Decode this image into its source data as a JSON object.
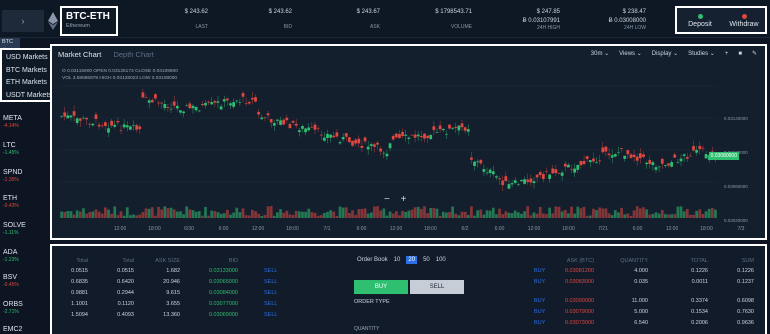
{
  "header": {
    "collapse_icon": "chevron-right-icon",
    "pair": "BTC-ETH",
    "pair_sub": "Ethereum",
    "stats": [
      {
        "value": "$ 243.62",
        "value2": "",
        "label": "LAST"
      },
      {
        "value": "$ 243.62",
        "value2": "",
        "label": "BID"
      },
      {
        "value": "$ 243.67",
        "value2": "",
        "label": "ASK"
      },
      {
        "value": "$ 1798543.71",
        "value2": "",
        "label": "VOLUME"
      },
      {
        "value": "$ 247.85",
        "value2": "Ƀ 0.03107991",
        "label": "24H HIGH"
      },
      {
        "value": "$ 238.47",
        "value2": "Ƀ 0.03008000",
        "label": "24H LOW"
      }
    ],
    "deposit_label": "Deposit",
    "withdraw_label": "Withdraw"
  },
  "market_select": "BTC",
  "markets_dropdown": [
    "USD Markets",
    "BTC Markets",
    "ETH Markets",
    "USDT Markets"
  ],
  "coins": [
    {
      "name": "META",
      "change": "-4.14%",
      "dir": "neg"
    },
    {
      "name": "LTC",
      "change": "-1.45%",
      "dir": "pos"
    },
    {
      "name": "SPND",
      "change": "-1.35%",
      "dir": "neg"
    },
    {
      "name": "ETH",
      "change": "-0.43%",
      "dir": "neg"
    },
    {
      "name": "SOLVE",
      "change": "-1.11%",
      "dir": "pos"
    },
    {
      "name": "ADA",
      "change": "-1.23%",
      "dir": "pos"
    },
    {
      "name": "BSV",
      "change": "-0.45%",
      "dir": "neg"
    },
    {
      "name": "ORBS",
      "change": "-2.71%",
      "dir": "pos"
    },
    {
      "name": "EMC2",
      "change": "",
      "dir": "neg"
    }
  ],
  "chart": {
    "tab_active": "Market Chart",
    "tab_inactive": "Depth Chart",
    "controls": [
      "30m ⌄",
      "Views ⌄",
      "Display ⌄",
      "Studies ⌄",
      "+",
      "■",
      "✎"
    ],
    "ohlc_line1": "O 0.03115900  OPEN  0.03125173  CLOSE  0.03109800",
    "ohlc_line2": "VOL  3.58686978  HIGH  0.03128023  LOW  0.03108000",
    "price_labels": [
      "0.03140000",
      "0.03100000",
      "0.03060000",
      "0.03020000"
    ],
    "current_price": "0.03080000",
    "x_labels": [
      "12:00",
      "18:00",
      "6/30",
      "6:00",
      "12:00",
      "18:00",
      "7/1",
      "6:00",
      "12:00",
      "18:00",
      "6/2",
      "6:00",
      "12:00",
      "18:00",
      "7/21",
      "6:00",
      "12:00",
      "18:00",
      "7/3"
    ],
    "zoom_minus": "−",
    "zoom_plus": "+"
  },
  "orderbook": {
    "title": "Order Book",
    "decimals": [
      "10",
      "20",
      "50",
      "100"
    ],
    "buy_label": "BUY",
    "sell_label": "SELL",
    "order_type_label": "ORDER TYPE",
    "quantity_label": "QUANTITY",
    "left_headers": [
      "Total",
      "Total",
      "ASK SIZE",
      "BID"
    ],
    "left_rows": [
      [
        "0.0515",
        "0.0515",
        "1.682",
        "0.03133000"
      ],
      [
        "0.6835",
        "0.6420",
        "20.946",
        "0.03065000"
      ],
      [
        "0.9881",
        "0.2944",
        "9.615",
        "0.03084000"
      ],
      [
        "1.1001",
        "0.1120",
        "3.655",
        "0.03077000"
      ],
      [
        "1.5094",
        "0.4093",
        "13.360",
        "0.03069000"
      ]
    ],
    "right_headers": [
      "ASK (BTC)",
      "QUANTITY",
      "TOTAL",
      "SUM"
    ],
    "right_rows": [
      [
        "BUY",
        "0.03081200",
        "4.000",
        "0.1226",
        "0.1226"
      ],
      [
        "BUY",
        "0.03083000",
        "0.035",
        "0.0011",
        "0.1237"
      ],
      [
        "BUY",
        "0.03090000",
        "11.000",
        "0.3374",
        "0.6098"
      ],
      [
        "BUY",
        "0.03079000",
        "5.000",
        "0.1534",
        "0.7630"
      ],
      [
        "BUY",
        "0.03073000",
        "6.540",
        "0.2006",
        "0.9636"
      ]
    ]
  }
}
